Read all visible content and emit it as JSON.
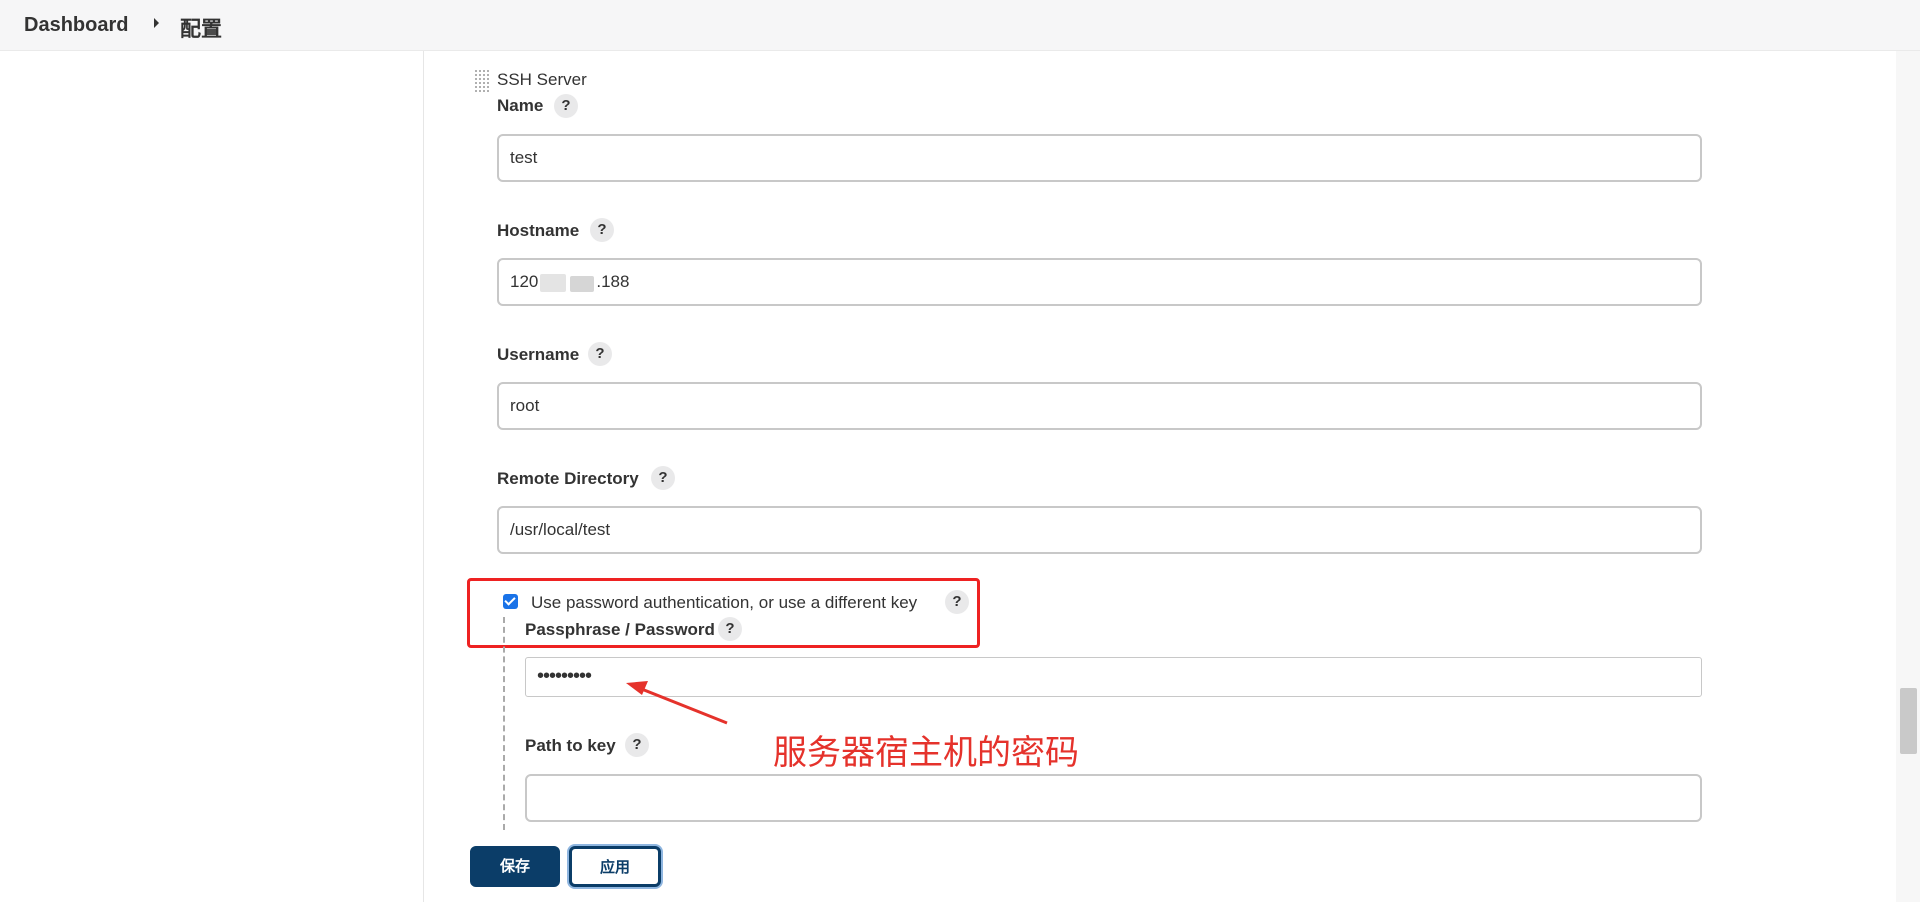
{
  "breadcrumb": {
    "home": "Dashboard",
    "current": "配置"
  },
  "section": {
    "title": "SSH Server"
  },
  "help_glyph": "?",
  "fields": {
    "name": {
      "label": "Name",
      "value": "test"
    },
    "hostname": {
      "label": "Hostname",
      "value_prefix": "120",
      "value_suffix": ".188"
    },
    "username": {
      "label": "Username",
      "value": "root"
    },
    "remote_directory": {
      "label": "Remote Directory",
      "value": "/usr/local/test"
    },
    "use_password": {
      "label": "Use password authentication, or use a different key",
      "checked": true
    },
    "passphrase": {
      "label": "Passphrase / Password",
      "value": "•••••••••"
    },
    "path_to_key": {
      "label": "Path to key",
      "value": ""
    }
  },
  "annotation": {
    "text": "服务器宿主机的密码",
    "color": "#e5322b"
  },
  "buttons": {
    "save": "保存",
    "apply": "应用"
  },
  "colors": {
    "primary": "#0b3d68",
    "highlight": "#ee2222",
    "checkbox": "#1a73e8"
  }
}
